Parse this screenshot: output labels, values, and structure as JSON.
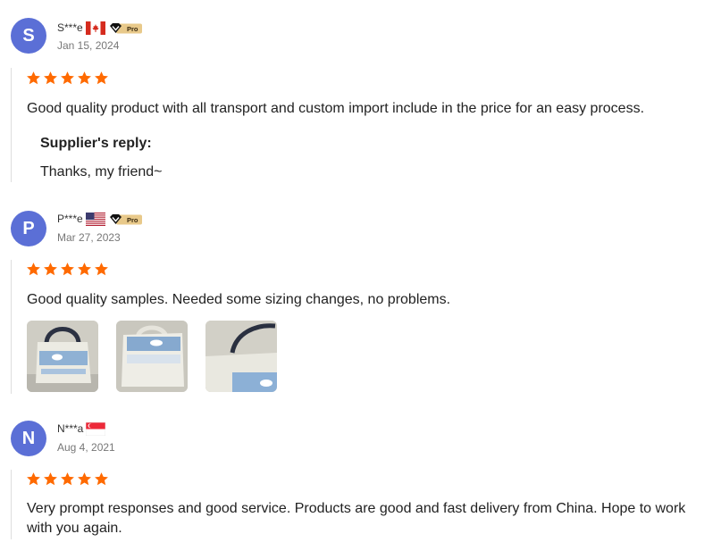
{
  "reviews": [
    {
      "avatar_letter": "S",
      "user": "S***e",
      "country_flag": "canada-flag-icon",
      "pro_badge": "Pro",
      "date": "Jan 15, 2024",
      "rating": 5,
      "text": "Good quality product with all transport and custom import include in the price for an easy process.",
      "reply_label": "Supplier's reply:",
      "reply_text": "Thanks, my friend~"
    },
    {
      "avatar_letter": "P",
      "user": "P***e",
      "country_flag": "usa-flag-icon",
      "pro_badge": "Pro",
      "date": "Mar 27, 2023",
      "rating": 5,
      "text": "Good quality samples. Needed some sizing changes, no problems.",
      "photos": [
        "tote-bag-photo-1",
        "tote-bag-photo-2",
        "tote-bag-photo-3"
      ]
    },
    {
      "avatar_letter": "N",
      "user": "N***a",
      "country_flag": "singapore-flag-icon",
      "date": "Aug 4, 2021",
      "rating": 5,
      "text": "Very prompt responses and good service. Products are good and fast delivery from China. Hope to work with you again."
    }
  ],
  "colors": {
    "avatar": "#5b6fd6",
    "star": "#ff6a00",
    "divider": "#dedede",
    "date": "#777777",
    "pro_badge": "#e8c98a"
  }
}
